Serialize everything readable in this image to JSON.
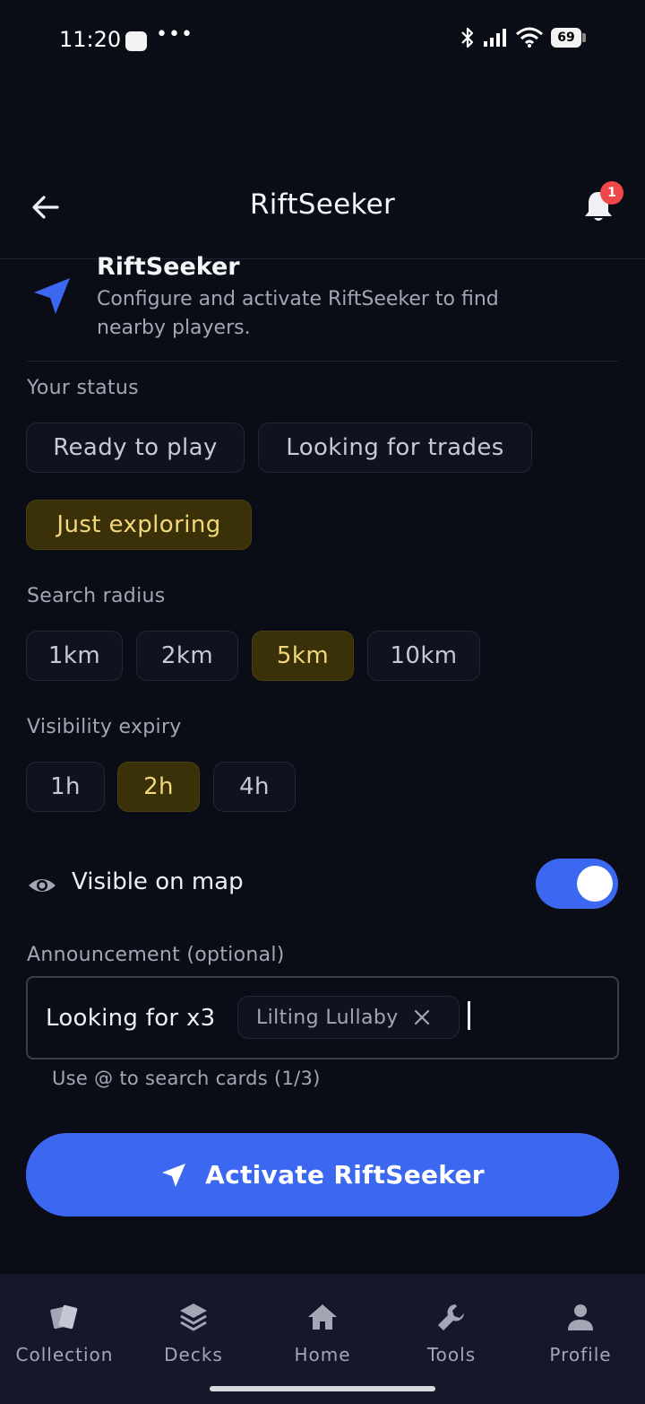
{
  "status_bar": {
    "time": "11:20",
    "battery": "69"
  },
  "header": {
    "title": "RiftSeeker",
    "notification_count": "1"
  },
  "intro": {
    "title": "RiftSeeker",
    "description": "Configure and activate RiftSeeker to find nearby players."
  },
  "status_section": {
    "label": "Your status",
    "options": [
      {
        "label": "Ready to play",
        "selected": false
      },
      {
        "label": "Looking for trades",
        "selected": false
      },
      {
        "label": "Just exploring",
        "selected": true
      }
    ]
  },
  "radius_section": {
    "label": "Search radius",
    "options": [
      {
        "label": "1km",
        "selected": false
      },
      {
        "label": "2km",
        "selected": false
      },
      {
        "label": "5km",
        "selected": true
      },
      {
        "label": "10km",
        "selected": false
      }
    ]
  },
  "expiry_section": {
    "label": "Visibility expiry",
    "options": [
      {
        "label": "1h",
        "selected": false
      },
      {
        "label": "2h",
        "selected": true
      },
      {
        "label": "4h",
        "selected": false
      }
    ]
  },
  "visibility": {
    "label": "Visible on map",
    "enabled": true
  },
  "announcement": {
    "label": "Announcement (optional)",
    "text": "Looking for x3",
    "card_tag": "Lilting Lullaby",
    "helper": "Use @ to search cards (1/3)"
  },
  "activate_button": {
    "label": "Activate RiftSeeker"
  },
  "bottom_nav": {
    "items": [
      {
        "label": "Collection",
        "icon": "cards-icon"
      },
      {
        "label": "Decks",
        "icon": "layers-icon"
      },
      {
        "label": "Home",
        "icon": "home-icon"
      },
      {
        "label": "Tools",
        "icon": "wrench-icon"
      },
      {
        "label": "Profile",
        "icon": "person-icon"
      }
    ]
  },
  "colors": {
    "background": "#0a0c16",
    "accent_blue": "#3c67f1",
    "selected_chip_bg": "#3a3108",
    "selected_chip_text": "#f4d77a",
    "badge_red": "#f0484a"
  }
}
